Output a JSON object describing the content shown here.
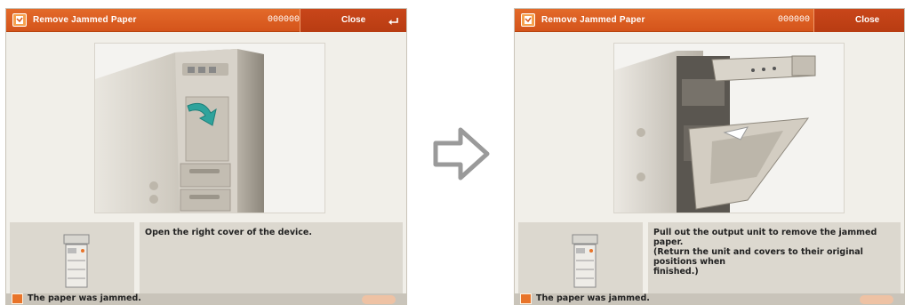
{
  "screens": [
    {
      "title": "Remove Jammed Paper",
      "counter": "000000",
      "close_label": "Close",
      "instruction": "Open the right cover of the device.",
      "status": "The paper was jammed."
    },
    {
      "title": "Remove Jammed Paper",
      "counter": "000000",
      "close_label": "Close",
      "instruction": "Pull out the output unit to remove the jammed paper.\n(Return the unit and covers to their original positions when\nfinished.)",
      "status": "The paper was jammed."
    }
  ],
  "colors": {
    "titlebar": "#d9591e",
    "close_button": "#bf4115",
    "screen_bg": "#f1efe9",
    "panel_bg": "#dcd8cf",
    "statusbar": "#c9c4ba",
    "arrow_green": "#2fa39c",
    "flow_arrow": "#9a9a9a"
  },
  "icons": {
    "title": "paper-jam-icon",
    "close": "enter-return-icon",
    "status": "paper-jam-icon",
    "flow": "right-arrow-outline-icon"
  }
}
